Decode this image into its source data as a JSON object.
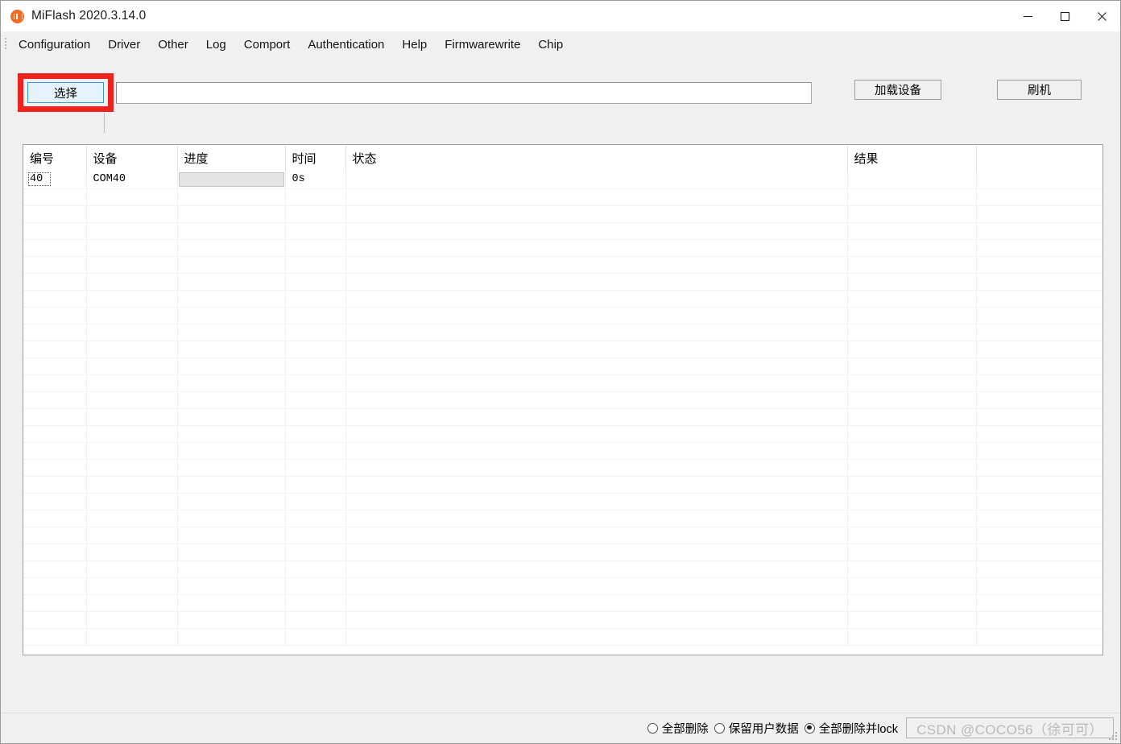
{
  "window": {
    "title": "MiFlash 2020.3.14.0",
    "icon": "mi-logo-icon",
    "minimize_label": "minimize-icon",
    "maximize_label": "maximize-icon",
    "close_label": "close-icon"
  },
  "menubar": {
    "items": [
      {
        "label": "Configuration"
      },
      {
        "label": "Driver"
      },
      {
        "label": "Other"
      },
      {
        "label": "Log"
      },
      {
        "label": "Comport"
      },
      {
        "label": "Authentication"
      },
      {
        "label": "Help"
      },
      {
        "label": "Firmwarewrite"
      },
      {
        "label": "Chip"
      }
    ]
  },
  "toolbar": {
    "select_label": "选择",
    "path_value": "",
    "path_placeholder": "",
    "load_device_label": "加载设备",
    "flash_label": "刷机",
    "highlight_color": "#ee2320"
  },
  "table": {
    "columns": [
      "编号",
      "设备",
      "进度",
      "时间",
      "状态",
      "结果",
      ""
    ],
    "rows": [
      {
        "number": "40",
        "device": "COM40",
        "progress": "",
        "progress_value": 0,
        "time": "0s",
        "status": "",
        "result": "",
        "extra": ""
      }
    ],
    "empty_row_count": 27
  },
  "statusbar": {
    "options": [
      {
        "label": "全部删除",
        "checked": false
      },
      {
        "label": "保留用户数据",
        "checked": false
      },
      {
        "label": "全部删除并lock",
        "checked": true
      }
    ],
    "panel_text": "CSDN @COCO56（徐可可）"
  }
}
